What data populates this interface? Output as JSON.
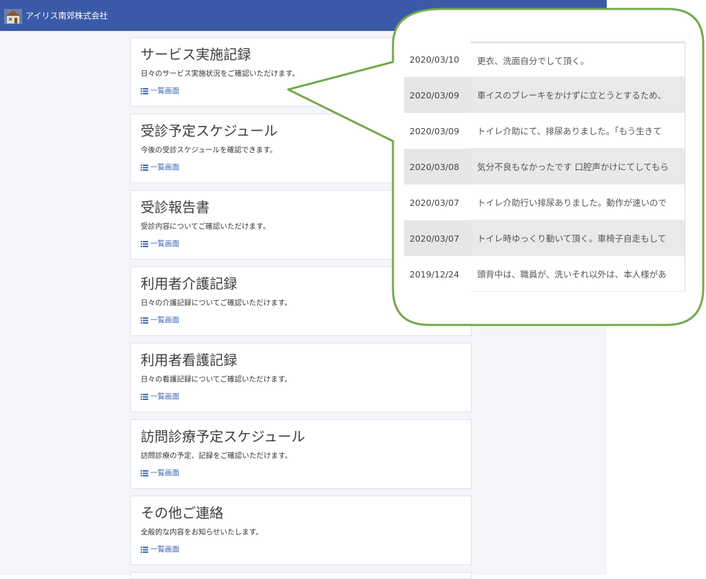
{
  "header": {
    "brand_name": "アイリス南郊株式会社",
    "logo_icon": "house-logo-icon",
    "background_color": "#3a5aa8"
  },
  "cards": [
    {
      "title": "サービス実施記録",
      "description": "日々のサービス実施状況をご確認いただけます。",
      "link_label": "一覧画面",
      "link_icon": "list-icon"
    },
    {
      "title": "受診予定スケジュール",
      "description": "今後の受診スケジュールを確認できます。",
      "link_label": "一覧画面",
      "link_icon": "list-icon"
    },
    {
      "title": "受診報告書",
      "description": "受診内容についてご確認いただけます。",
      "link_label": "一覧画面",
      "link_icon": "list-icon"
    },
    {
      "title": "利用者介護記録",
      "description": "日々の介護記録についてご確認いただけます。",
      "link_label": "一覧画面",
      "link_icon": "list-icon"
    },
    {
      "title": "利用者看護記録",
      "description": "日々の看護記録についてご確認いただけます。",
      "link_label": "一覧画面",
      "link_icon": "list-icon"
    },
    {
      "title": "訪問診療予定スケジュール",
      "description": "訪問診療の予定、記録をご確認いただけます。",
      "link_label": "一覧画面",
      "link_icon": "list-icon"
    },
    {
      "title": "その他ご連絡",
      "description": "全般的な内容をお知らせいたします。",
      "link_label": "一覧画面",
      "link_icon": "list-icon"
    }
  ],
  "callout": {
    "border_color": "#73a94b",
    "records": [
      {
        "date": "2020/03/10",
        "text": "更衣、洗面自分でして頂く。"
      },
      {
        "date": "2020/03/09",
        "text": "車イスのブレーキをかけずに立とうとするため、"
      },
      {
        "date": "2020/03/09",
        "text": "トイレ介助にて、排尿ありました。「もう生きて"
      },
      {
        "date": "2020/03/08",
        "text": "気分不良もなかったです 口腔声かけにてしてもら"
      },
      {
        "date": "2020/03/07",
        "text": "トイレ介助行い排尿ありました。動作が速いので"
      },
      {
        "date": "2020/03/07",
        "text": "トイレ時ゆっくり動いて頂く。車椅子自走もして"
      },
      {
        "date": "2019/12/24",
        "text": "頭背中は、職員が、洗いそれ以外は、本人様があ"
      }
    ]
  }
}
